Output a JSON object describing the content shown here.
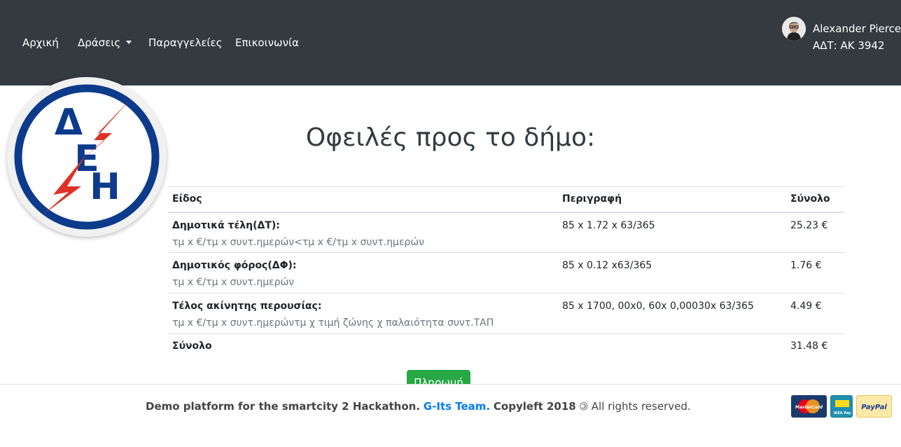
{
  "nav": {
    "items": [
      {
        "label": "Αρχική"
      },
      {
        "label": "Δράσεις"
      },
      {
        "label": "Παραγγελείες"
      },
      {
        "label": "Επικοινωνία"
      }
    ],
    "user": {
      "name": "Alexander Pierce",
      "id": "ΑΔΤ: ΑΚ 3942"
    }
  },
  "logo": {
    "letters": [
      "Δ",
      "Ε",
      "Η"
    ],
    "colors": {
      "blue": "#0d3b8c",
      "red": "#e03127"
    }
  },
  "main": {
    "title": "Οφειλές προς το δήμο:",
    "table": {
      "headers": [
        "Είδος",
        "Περιγραφή",
        "Σύνολο"
      ],
      "rows": [
        {
          "title": "Δημοτικά τέλη(ΔΤ):",
          "sub": "τμ x €/τμ x συντ.ημερών<τμ x €/τμ x συντ.ημερών",
          "desc": "85 x 1.72 x 63/365",
          "total": "25.23 €"
        },
        {
          "title": "Δημοτικός φόρος(ΔΦ):",
          "sub": "τμ x €/τμ x συντ.ημερών",
          "desc": "85 x 0.12 x63/365",
          "total": "1.76 €"
        },
        {
          "title": "Τέλος ακίνητης περουσίας:",
          "sub": "τμ x €/τμ x συντ.ημερώντμ χ τιμή ζώνης χ παλαιότητα συντ.ΤΑΠ",
          "desc": "85 x 1700, 00x0, 60x 0,00030x 63/365",
          "total": "4.49 €"
        }
      ],
      "sum_label": "Σύνολο",
      "sum_total": "31.48 €"
    },
    "pay_label": "Πληρωμή"
  },
  "footer": {
    "text_1": "Demo platform for the smartcity 2 Hackathon.",
    "team": "G-Its Team.",
    "text_2": "Copyleft 2018",
    "symbol": "🄯",
    "text_3": "All rights reserved.",
    "cards": [
      "MasterCard",
      "IKEA Pay",
      "PayPal"
    ]
  },
  "colors": {
    "navbar": "#343a40",
    "pay_button": "#28a745",
    "link": "#007bff"
  }
}
